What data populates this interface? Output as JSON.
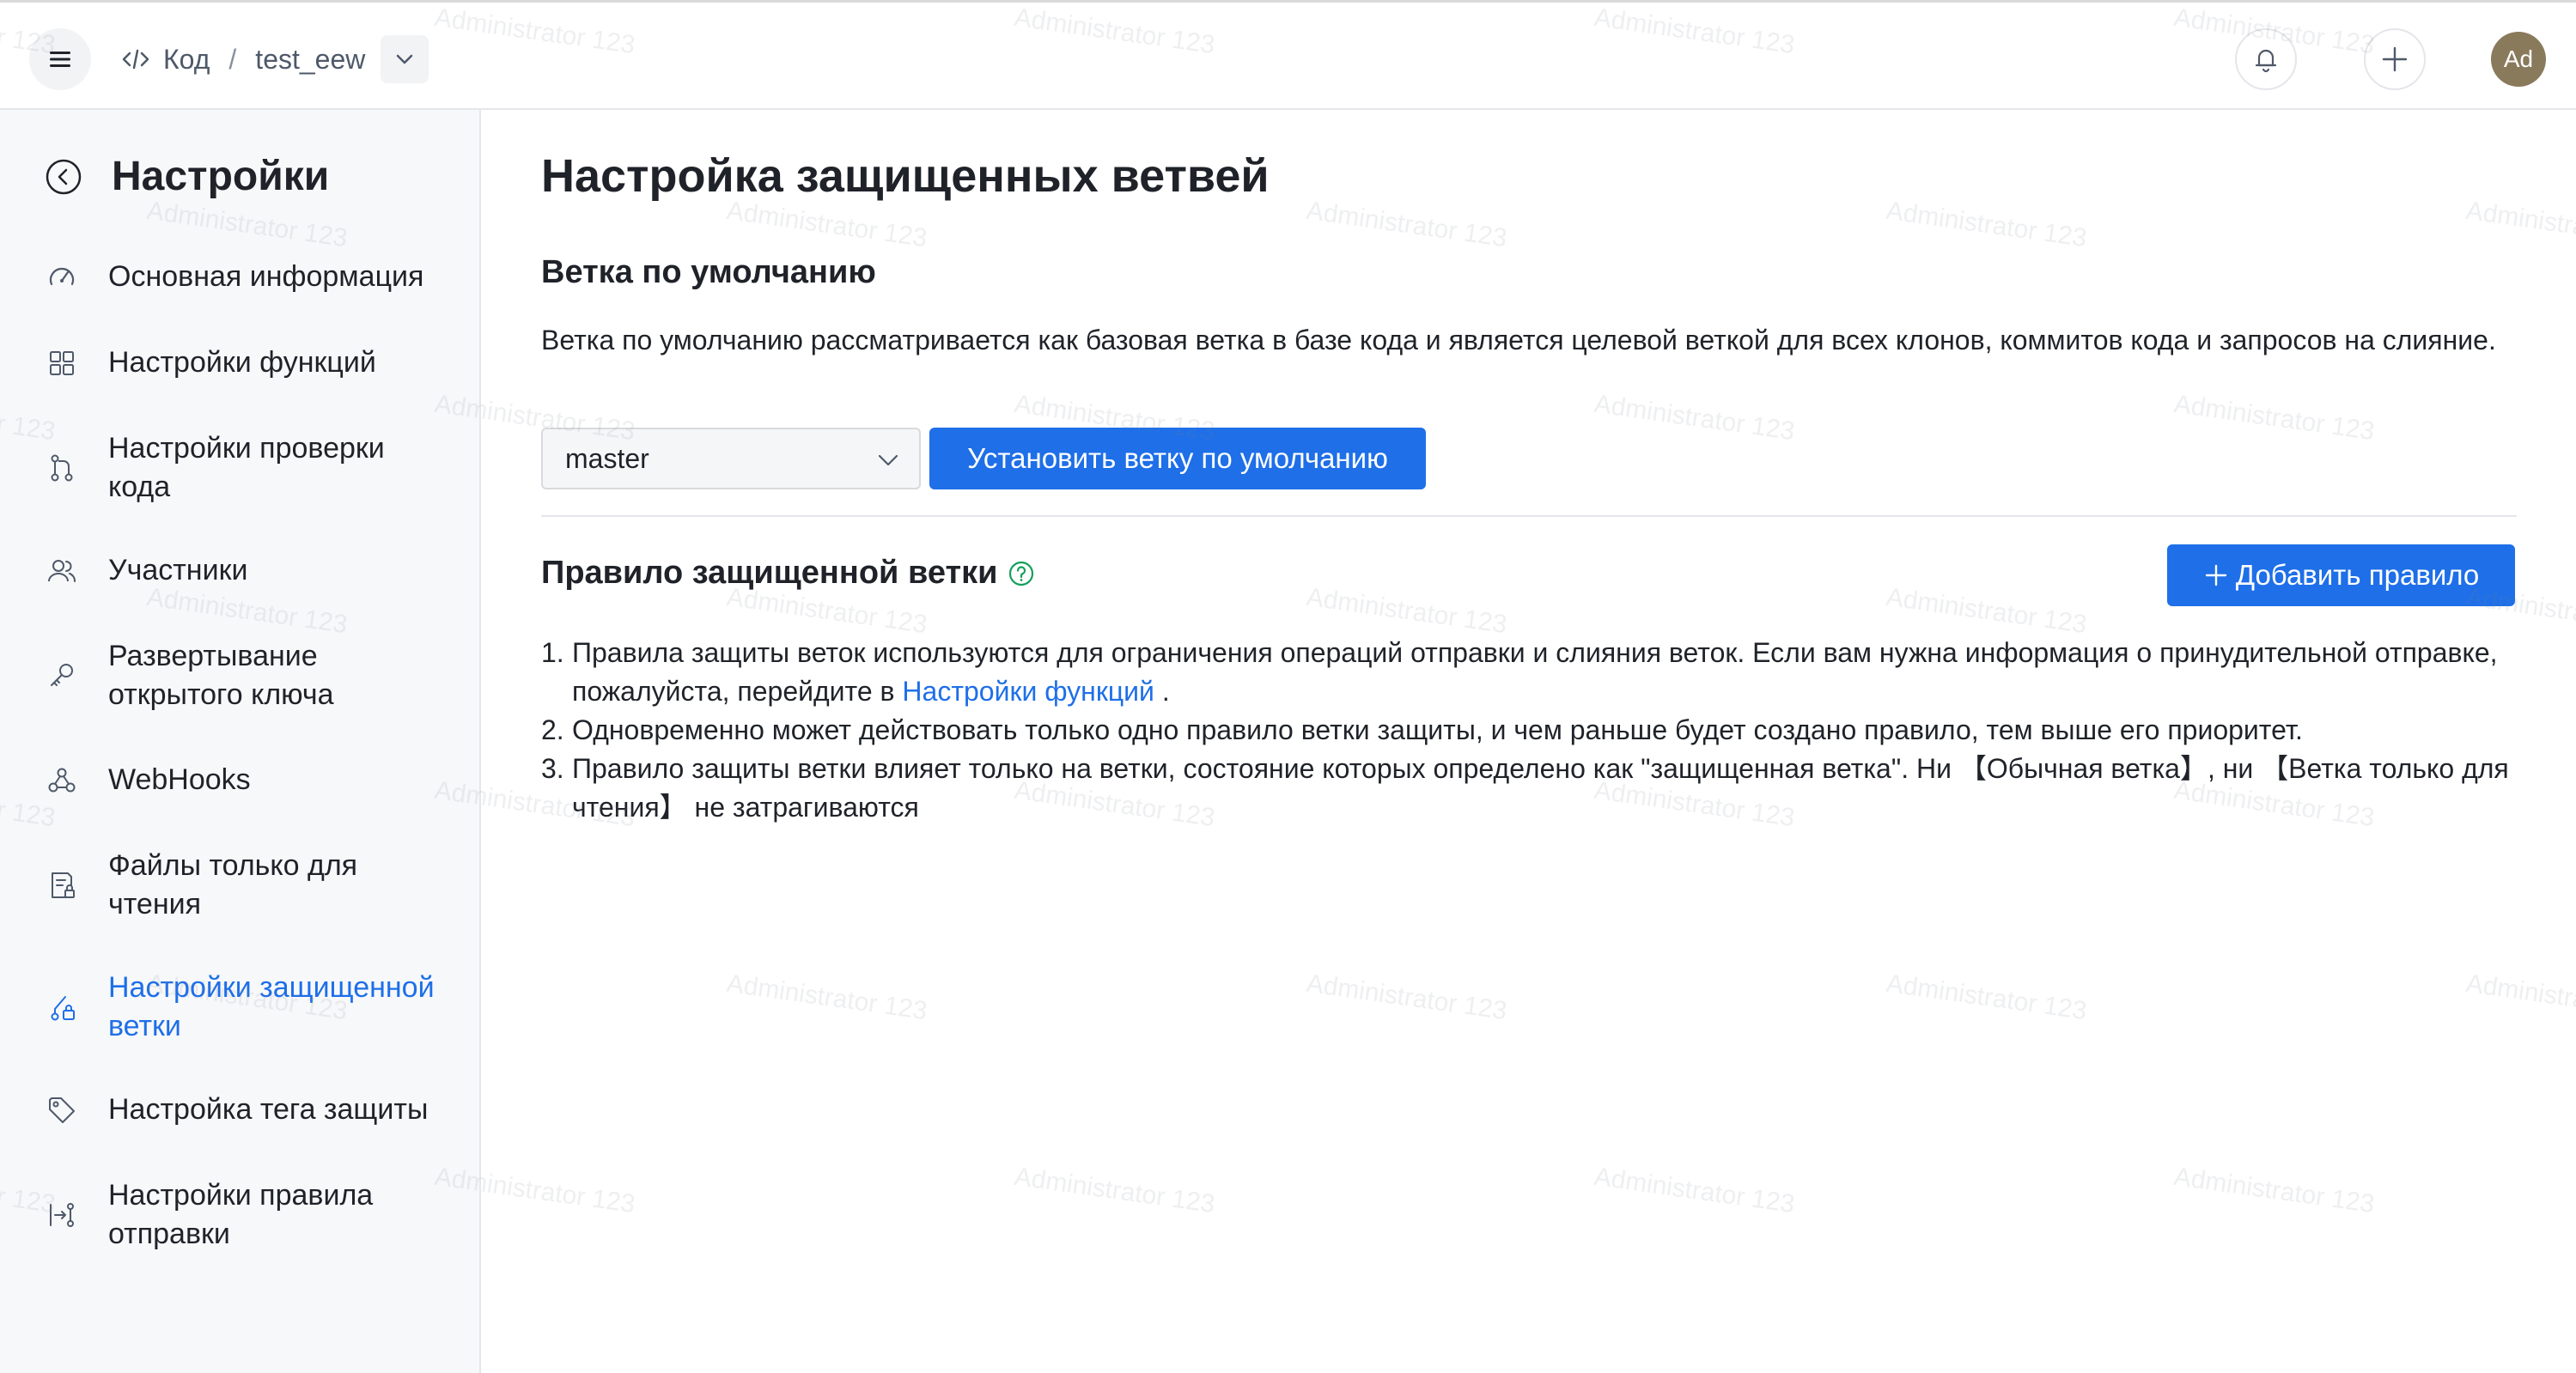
{
  "header": {
    "breadcrumb_root": "Код",
    "breadcrumb_separator": "/",
    "breadcrumb_repo": "test_eew",
    "avatar_initials": "Ad"
  },
  "sidebar": {
    "title": "Настройки",
    "items": [
      {
        "label": "Основная информация",
        "icon": "gauge-icon"
      },
      {
        "label": "Настройки функций",
        "icon": "grid-icon"
      },
      {
        "label": "Настройки проверки кода",
        "icon": "branch-merge-icon"
      },
      {
        "label": "Участники",
        "icon": "users-icon"
      },
      {
        "label": "Развертывание открытого ключа",
        "icon": "key-icon"
      },
      {
        "label": "WebHooks",
        "icon": "webhook-icon"
      },
      {
        "label": "Файлы только для чтения",
        "icon": "file-lock-icon"
      },
      {
        "label": "Настройки защищенной ветки",
        "icon": "branch-lock-icon",
        "active": true
      },
      {
        "label": "Настройка тега защиты",
        "icon": "tag-icon"
      },
      {
        "label": "Настройки правила отправки",
        "icon": "push-rule-icon"
      }
    ]
  },
  "main": {
    "title": "Настройка защищенных ветвей",
    "default_branch": {
      "heading": "Ветка по умолчанию",
      "description": "Ветка по умолчанию рассматривается как базовая ветка в базе кода и является целевой веткой для всех клонов, коммитов кода и запросов на слияние.",
      "selected_branch": "master",
      "set_button": "Установить ветку по умолчанию"
    },
    "protected_rule": {
      "heading": "Правило защищенной ветки",
      "add_button": "Добавить правило",
      "rules": [
        {
          "num": "1.",
          "text_before": "Правила защиты веток используются для ограничения операций отправки и слияния веток. Если вам нужна информация о принудительной отправке, пожалуйста, перейдите в ",
          "link": "Настройки функций",
          "text_after": " ."
        },
        {
          "num": "2.",
          "text": "Одновременно может действовать только одно правило ветки защиты, и чем раньше будет создано правило, тем выше его приоритет."
        },
        {
          "num": "3.",
          "text": "Правило защиты ветки влияет только на ветки, состояние которых определено как \"защищенная ветка\". Ни 【Обычная ветка】, ни 【Ветка только для чтения】 не затрагиваются"
        }
      ]
    }
  },
  "watermark": "Administrator 123",
  "colors": {
    "primary": "#1e6fe8",
    "sidebar_bg": "#f7f8fa",
    "help_icon": "#13a05a"
  }
}
